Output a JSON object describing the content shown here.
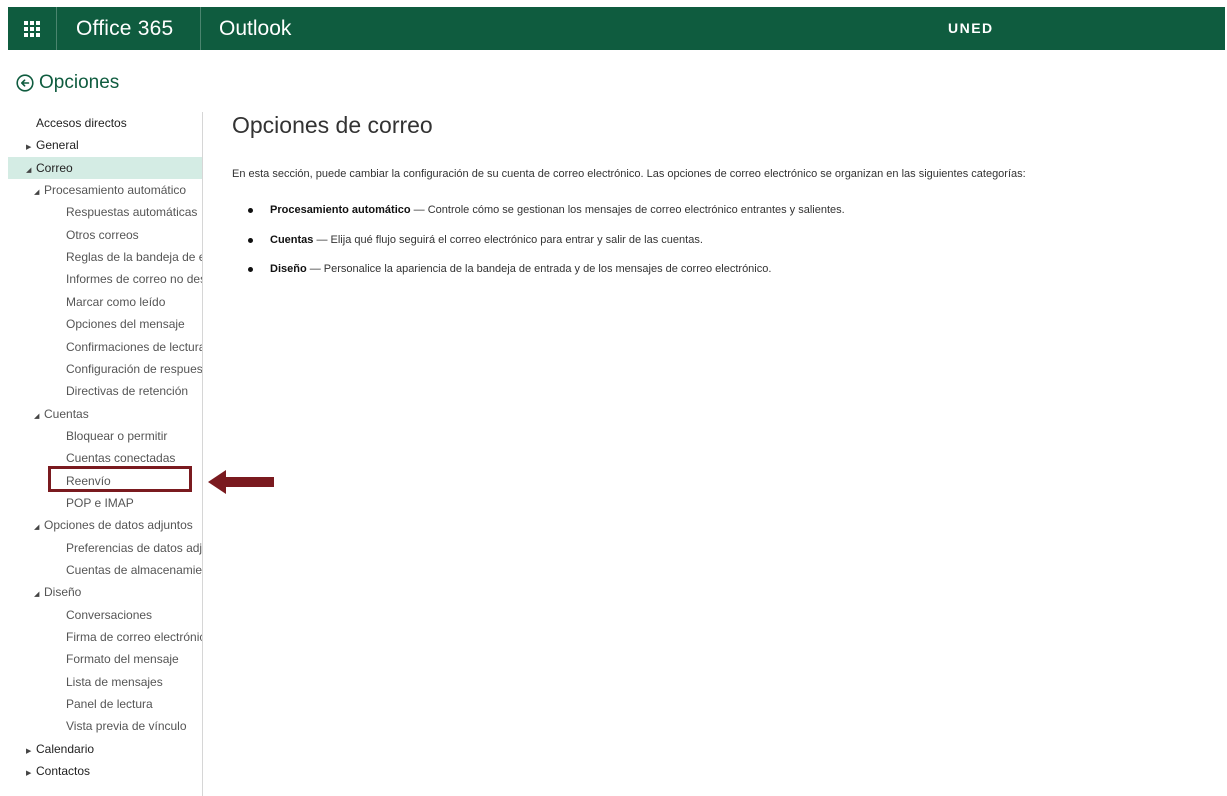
{
  "header": {
    "brand": "Office 365",
    "app": "Outlook",
    "org": "UNED",
    "background": "#0f5c3f"
  },
  "back": {
    "label": "Opciones",
    "icon": "back-arrow-circle-icon"
  },
  "sidebar": {
    "items": [
      {
        "label": "Accesos directos",
        "level": 0,
        "expander": ""
      },
      {
        "label": "General",
        "level": 0,
        "expander": "collapsed"
      },
      {
        "label": "Correo",
        "level": 0,
        "expander": "expanded",
        "selected": true
      },
      {
        "label": "Procesamiento automático",
        "level": 1,
        "expander": "expanded"
      },
      {
        "label": "Respuestas automáticas",
        "level": 2,
        "expander": ""
      },
      {
        "label": "Otros correos",
        "level": 2,
        "expander": ""
      },
      {
        "label": "Reglas de la bandeja de er",
        "level": 2,
        "expander": ""
      },
      {
        "label": "Informes de correo no des",
        "level": 2,
        "expander": ""
      },
      {
        "label": "Marcar como leído",
        "level": 2,
        "expander": ""
      },
      {
        "label": "Opciones del mensaje",
        "level": 2,
        "expander": ""
      },
      {
        "label": "Confirmaciones de lectura",
        "level": 2,
        "expander": ""
      },
      {
        "label": "Configuración de respuest",
        "level": 2,
        "expander": ""
      },
      {
        "label": "Directivas de retención",
        "level": 2,
        "expander": ""
      },
      {
        "label": "Cuentas",
        "level": 1,
        "expander": "expanded"
      },
      {
        "label": "Bloquear o permitir",
        "level": 2,
        "expander": ""
      },
      {
        "label": "Cuentas conectadas",
        "level": 2,
        "expander": ""
      },
      {
        "label": "Reenvío",
        "level": 2,
        "expander": "",
        "highlighted": true
      },
      {
        "label": "POP e IMAP",
        "level": 2,
        "expander": ""
      },
      {
        "label": "Opciones de datos adjuntos",
        "level": 1,
        "expander": "expanded"
      },
      {
        "label": "Preferencias de datos adju",
        "level": 2,
        "expander": ""
      },
      {
        "label": "Cuentas de almacenamien",
        "level": 2,
        "expander": ""
      },
      {
        "label": "Diseño",
        "level": 1,
        "expander": "expanded"
      },
      {
        "label": "Conversaciones",
        "level": 2,
        "expander": ""
      },
      {
        "label": "Firma de correo electrónic",
        "level": 2,
        "expander": ""
      },
      {
        "label": "Formato del mensaje",
        "level": 2,
        "expander": ""
      },
      {
        "label": "Lista de mensajes",
        "level": 2,
        "expander": ""
      },
      {
        "label": "Panel de lectura",
        "level": 2,
        "expander": ""
      },
      {
        "label": "Vista previa de vínculo",
        "level": 2,
        "expander": ""
      },
      {
        "label": "Calendario",
        "level": 0,
        "expander": "collapsed"
      },
      {
        "label": "Contactos",
        "level": 0,
        "expander": "collapsed"
      }
    ],
    "selected_color": "#d4ece4"
  },
  "annotation": {
    "box_color": "#7a1a1f",
    "arrow_icon": "left-arrow-icon"
  },
  "main": {
    "title": "Opciones de correo",
    "intro": "En esta sección, puede cambiar la configuración de su cuenta de correo electrónico. Las opciones de correo electrónico se organizan en las siguientes categorías:",
    "bullets": [
      {
        "term": "Procesamiento automático",
        "desc": "— Controle cómo se gestionan los mensajes de correo electrónico entrantes y salientes."
      },
      {
        "term": "Cuentas",
        "desc": "— Elija qué flujo seguirá el correo electrónico para entrar y salir de las cuentas."
      },
      {
        "term": "Diseño",
        "desc": "— Personalice la apariencia de la bandeja de entrada y de los mensajes de correo electrónico."
      }
    ]
  }
}
